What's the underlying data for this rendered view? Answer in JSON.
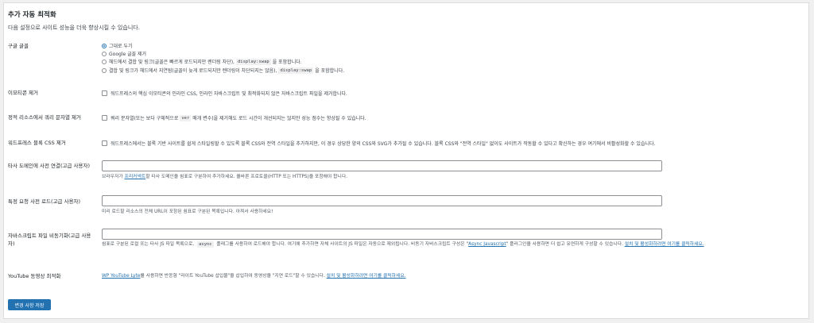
{
  "section": {
    "title": "추가 자동 최적화",
    "subtitle": "다음 설정으로 사이트 성능을 더욱 향상시킬 수 있습니다."
  },
  "google_fonts": {
    "label": "구글 글꼴",
    "options": [
      {
        "parts": [
          "그대로 두기"
        ],
        "selected": true
      },
      {
        "parts": [
          "Google 글꼴 제거"
        ],
        "selected": false
      },
      {
        "parts": [
          "헤드에서 결합 및 링크(글꼴은 빠르게 로드되지만 렌더링 차단),",
          "display:swap",
          "을 포함합니다."
        ],
        "selected": false
      },
      {
        "parts": [
          "결합 및 링크가 헤드에서 지연됨(글꼴이 늦게 로드되지만 렌더링이 차단되지는 않음),",
          "display:swap",
          "을 포함합니다."
        ],
        "selected": false
      }
    ]
  },
  "emoji": {
    "label": "이모티콘 제거",
    "text": "워드프레스의 핵심 이모티콘의 인라인 CSS, 인라인 자바스크립트 및 최적화되지 않은 자바스크립트 파일을 제거합니다."
  },
  "query_strings": {
    "label": "정적 리소스에서 쿼리 문자열 제거",
    "text_before": "쿼리 문자열(또는 보다 구체적으로",
    "code": "ver",
    "text_after": "매개 변수)을 제거해도 로드 시간이 개선되지는 않지만 성능 점수는 향상될 수 있습니다."
  },
  "block_css": {
    "label": "워드프레스 블록 CSS 제거",
    "text": "워드프레스에서는 블록 기반 사이트를 쉽게 스타일링할 수 있도록 블록 CSS와 전역 스타일을 추가하지만, 이 경우 상당한 양의 CSS와 SVG가 추가될 수 있습니다. 블록 CSS와 \"전역 스타일\" 없이도 사이트가 작동할 수 있다고 확신하는 경우 여기에서 비활성화할 수 있습니다."
  },
  "preconnect": {
    "label": "타사 도메인에 사전 연결(고급 사용자)",
    "value": "",
    "desc_before": "브라우저가",
    "desc_link": "프리커넥트",
    "desc_after": "할 타사 도메인을 쉼표로 구분하여 추가하세요. 올바른 프로토콜(HTTP 또는 HTTPS)을 포함해야 합니다."
  },
  "preload": {
    "label": "특정 요청 사전 로드(고급 사용자)",
    "value": "",
    "desc": "미리 로드할 리소스의 전체 URL이 포함된 쉼표로 구분된 목록입니다. 아껴서 사용하세요!"
  },
  "async_js": {
    "label": "자바스크립트 파일 비동기화(고급 사용자)",
    "value": "",
    "desc_1": "쉼표로 구분된 로컬 또는 타사 JS 파일 목록으로,",
    "desc_code": "async",
    "desc_2": "플래그를 사용하여 로드해야 합니다. 여기에 추가하면 자체 사이트의 JS 파일은 자동으로 제외됩니다. 비동기 자바스크립트 구성은 \"",
    "desc_link1": "Async Javascript",
    "desc_3": "\" 플러그인을 사용하면 더 쉽고 유연하게 구성할 수 있습니다.",
    "desc_link2": "설치 및 활성화하려면 여기를 클릭하세요."
  },
  "youtube": {
    "label": "YouTube 동영상 최적화",
    "link1": "WP YouTube Lyte",
    "text": "를 사용하면 반응형 \"라이트 YouTube 삽입물\"을 삽입하여 동영상을 \"지연 로드\"할 수 있습니다.",
    "link2": "설치 및 활성화하려면 여기를 클릭하세요."
  },
  "save_label": "변경 사항 저장",
  "colors": {
    "accent": "#2271b1",
    "background": "#f0f0f1"
  }
}
